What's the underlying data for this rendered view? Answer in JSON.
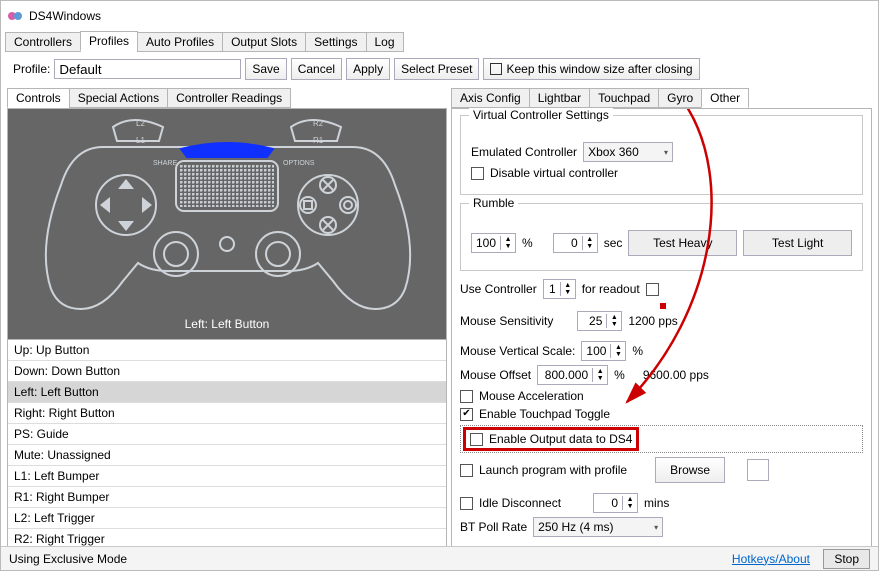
{
  "window": {
    "title": "DS4Windows"
  },
  "mainTabs": [
    "Controllers",
    "Profiles",
    "Auto Profiles",
    "Output Slots",
    "Settings",
    "Log"
  ],
  "activeMainTab": 1,
  "profileRow": {
    "label": "Profile:",
    "name": "Default",
    "save": "Save",
    "cancel": "Cancel",
    "apply": "Apply",
    "selectPreset": "Select Preset",
    "keepSize": "Keep this window size after closing"
  },
  "leftTabs": [
    "Controls",
    "Special Actions",
    "Controller Readings"
  ],
  "activeLeftTab": 0,
  "controllerCaption": "Left: Left Button",
  "mappings": [
    {
      "label": "Up: Up Button"
    },
    {
      "label": "Down: Down Button"
    },
    {
      "label": "Left: Left Button",
      "selected": true
    },
    {
      "label": "Right: Right Button"
    },
    {
      "label": "PS: Guide"
    },
    {
      "label": "Mute: Unassigned"
    },
    {
      "label": "L1: Left Bumper"
    },
    {
      "label": "R1: Right Bumper"
    },
    {
      "label": "L2: Left Trigger"
    },
    {
      "label": "R2: Right Trigger"
    }
  ],
  "rightTabs": [
    "Axis Config",
    "Lightbar",
    "Touchpad",
    "Gyro",
    "Other"
  ],
  "activeRightTab": 4,
  "virtual": {
    "groupTitle": "Virtual Controller Settings",
    "emuLabel": "Emulated Controller",
    "emuValue": "Xbox 360",
    "disable": "Disable virtual controller"
  },
  "rumble": {
    "title": "Rumble",
    "pct": "100",
    "pctUnit": "%",
    "sec": "0",
    "secUnit": "sec",
    "heavy": "Test Heavy",
    "light": "Test Light"
  },
  "useController": {
    "label": "Use Controller",
    "value": "1",
    "readout": "for readout"
  },
  "mouseSensitivity": {
    "label": "Mouse Sensitivity",
    "value": "25",
    "pps": "1200 pps"
  },
  "mouseVerticalScale": {
    "label": "Mouse Vertical Scale:",
    "value": "100",
    "unit": "%"
  },
  "mouseOffset": {
    "label": "Mouse Offset",
    "value": "800.000",
    "unit": "%",
    "pps": "9600.00 pps"
  },
  "flags": {
    "mouseAccel": "Mouse Acceleration",
    "touchpadToggle": "Enable Touchpad Toggle",
    "outputDS4": "Enable Output data to DS4",
    "launchProgram": "Launch program with profile"
  },
  "checks": {
    "mouseAccel": false,
    "touchpadToggle": true,
    "outputDS4": false,
    "launchProgram": false,
    "readout": false,
    "idle": false,
    "disableVC": false,
    "keepSize": false
  },
  "browse": "Browse",
  "idle": {
    "label": "Idle Disconnect",
    "value": "0",
    "unit": "mins"
  },
  "btPoll": {
    "label": "BT Poll Rate",
    "value": "250 Hz (4 ms)"
  },
  "status": {
    "mode": "Using Exclusive Mode",
    "link": "Hotkeys/About",
    "stop": "Stop"
  }
}
